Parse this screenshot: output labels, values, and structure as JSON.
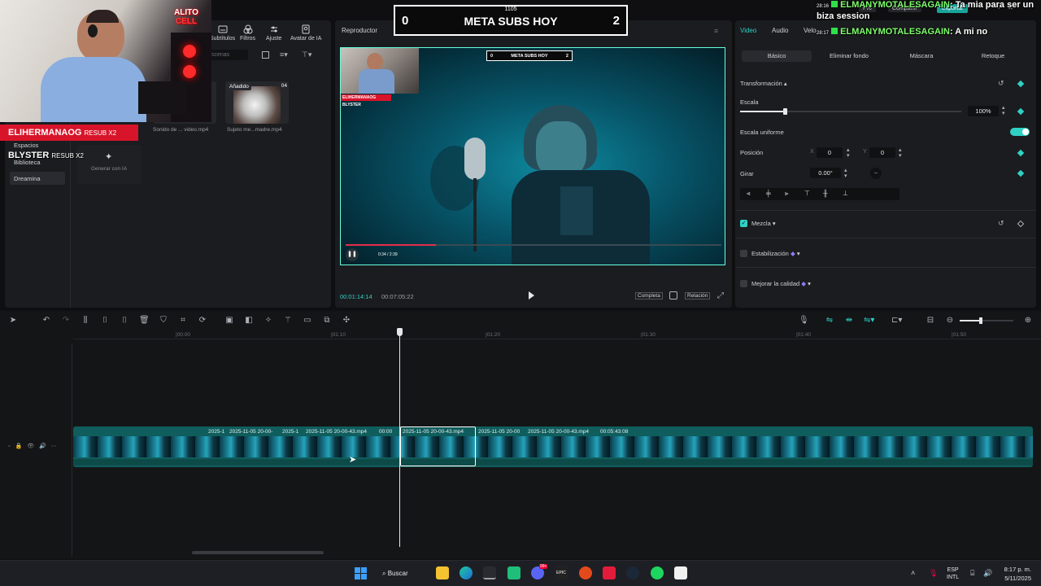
{
  "top_toolbar": {
    "tools": [
      "Subtítulos",
      "Filtros",
      "Ajuste",
      "Avatar de IA"
    ]
  },
  "media": {
    "search_placeholder": "scenas",
    "items": [
      {
        "name": "Sonido de ... video.mp4"
      },
      {
        "name": "Sujeto me...madre.mp4",
        "badge": "Añadido",
        "duration": "04"
      }
    ],
    "generate_label": "Generar con IA"
  },
  "left_nav": {
    "items": [
      "Espacios",
      "Biblioteca",
      "Dreamina"
    ]
  },
  "preview": {
    "title": "Reproductor",
    "current_time": "00:01:14:14",
    "total_time": "00:07:05:22",
    "btn_full": "Completa",
    "btn_ratio": "Relación",
    "inner_scoreboard": {
      "left": "0",
      "title": "META SUBS HOY",
      "right": "2"
    },
    "inner_player_time": "0:34 / 2:39",
    "inner_names": [
      "ELIHERMANAOG",
      "BLYSTER"
    ]
  },
  "scoreboard": {
    "top": "1105",
    "left": "0",
    "title": "META SUBS HOY",
    "right": "2"
  },
  "inspector": {
    "tabs": [
      "Video",
      "Audio",
      "Velo"
    ],
    "subtabs": [
      "Básico",
      "Eliminar fondo",
      "Máscara",
      "Retoque"
    ],
    "section_transform": "Transformación",
    "scale_label": "Escala",
    "scale_value": "100%",
    "uniform_label": "Escala uniforme",
    "position_label": "Posición",
    "pos_x_label": "X",
    "pos_x": "0",
    "pos_y_label": "Y",
    "pos_y": "0",
    "rotate_label": "Girar",
    "rotate_value": "0.00°",
    "blend_label": "Mezcla",
    "stabilization_label": "Estabilización",
    "quality_label": "Mejorar la calidad",
    "colors": {
      "accent": "#2fd1c5"
    }
  },
  "top_right": {
    "btn_pro": "Pro",
    "btn_share": "Compartir",
    "btn_export": "Exportar"
  },
  "timeline": {
    "ruler_labels": [
      "|00:00",
      "|01:10",
      "|01:20",
      "|01:30",
      "|01:40",
      "|01:50"
    ],
    "clip_labels": [
      "2025-1",
      "2025-11-05 20-00-",
      "2025-1",
      "2025-11-05 20-00-43.mp4",
      "00:00",
      "2025-11-05 20-00-43.mp4",
      "2025-11-05 20-00",
      "2025-11-05 20-00-43.mp4",
      "00:05:43:08"
    ]
  },
  "stream_overlay": {
    "logo_text": "ALITO",
    "logo_sub": "CELL",
    "names": [
      {
        "name": "ELIHERMANAOG",
        "suffix": "RESUB X2"
      },
      {
        "name": "BLYSTER",
        "suffix": "RESUB X2"
      }
    ],
    "chat": [
      {
        "time": "28:16",
        "user": "ELMANYMOTALESAGAIN",
        "msg": ": Ta mia para ser un biza session"
      },
      {
        "time": "28:17",
        "user": "ELMANYMOTALESAGAIN",
        "msg": ": A mi no"
      }
    ]
  },
  "taskbar": {
    "search": "Buscar",
    "lang_top": "ESP",
    "lang_bottom": "INTL",
    "time": "8:17 p. m.",
    "date": "5/11/2025",
    "badge": "99+"
  }
}
